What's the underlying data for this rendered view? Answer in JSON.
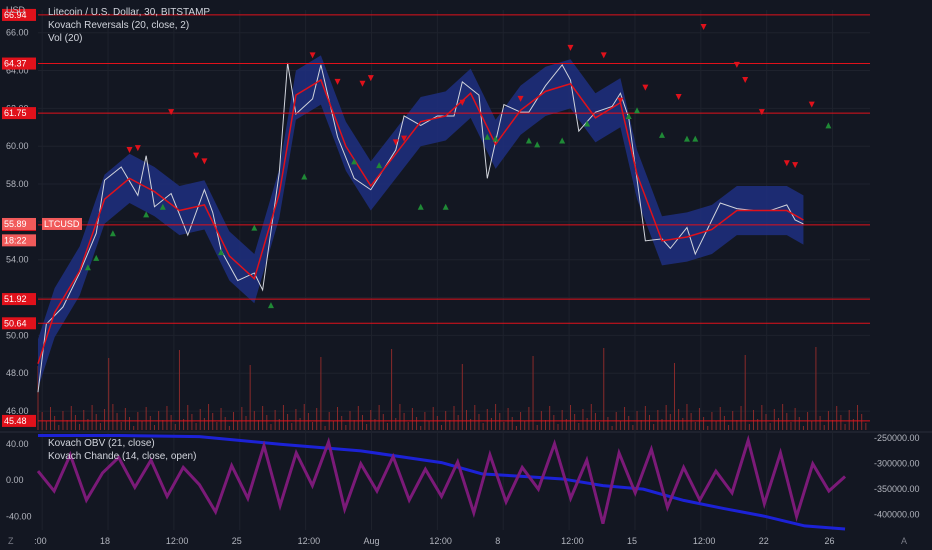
{
  "header": {
    "currency": "USD",
    "legend": [
      "Litecoin / U.S. Dollar, 30, BITSTAMP",
      "Kovach Reversals (20, close, 2)",
      "Vol (20)"
    ],
    "lower_legend": [
      "Kovach OBV (21, close)",
      "Kovach Chande (14, close, open)"
    ]
  },
  "footer": {
    "left_button": "Z",
    "right_button": "A"
  },
  "colors": {
    "background": "#131722",
    "level_line": "#e0111b",
    "price": "#d1d4dc",
    "band": "#1e2f80",
    "ma": "#e0111b",
    "signal_up": "#26a69a",
    "signal_down": "#e0111b",
    "obv": "#1c22d6",
    "chande": "#7b1a78",
    "volume": "#8a2a2a"
  },
  "chart_data": [
    {
      "type": "line",
      "title": "Litecoin / U.S. Dollar, 30, BITSTAMP",
      "symbol": "LTCUSD",
      "ylabel": "USD",
      "ylim": [
        45.0,
        67.2
      ],
      "y_ticks": [
        "46.00",
        "48.00",
        "50.00",
        "52.00",
        "54.00",
        "56.00",
        "58.00",
        "60.00",
        "62.00",
        "64.00",
        "66.00"
      ],
      "x_ticks": [
        ":00",
        "18",
        "12:00",
        "25",
        "12:00",
        "Aug",
        "12:00",
        "8",
        "12:00",
        "15",
        "12:00",
        "22",
        "26"
      ],
      "price_labels": [
        {
          "text": "55.89",
          "value": 55.89,
          "kind": "last"
        },
        {
          "text": "18:22",
          "value": 55.5,
          "kind": "countdown"
        },
        {
          "text": "LTCUSD",
          "value": 55.89,
          "kind": "symbol"
        }
      ],
      "levels": [
        {
          "text": "66.94",
          "value": 66.94
        },
        {
          "text": "64.37",
          "value": 64.37
        },
        {
          "text": "61.75",
          "value": 61.75
        },
        {
          "text": "55.84",
          "value": 55.84
        },
        {
          "text": "51.92",
          "value": 51.92
        },
        {
          "text": "50.64",
          "value": 50.64
        },
        {
          "text": "45.48",
          "value": 45.48
        }
      ],
      "series": [
        {
          "kind": "close",
          "points": [
            [
              0,
              47.0
            ],
            [
              0.01,
              50.6
            ],
            [
              0.03,
              51.5
            ],
            [
              0.05,
              53.3
            ],
            [
              0.07,
              55.4
            ],
            [
              0.08,
              58.2
            ],
            [
              0.1,
              58.9
            ],
            [
              0.12,
              57.4
            ],
            [
              0.13,
              59.5
            ],
            [
              0.14,
              56.8
            ],
            [
              0.16,
              57.5
            ],
            [
              0.18,
              55.3
            ],
            [
              0.2,
              57.7
            ],
            [
              0.21,
              56.5
            ],
            [
              0.22,
              54.5
            ],
            [
              0.24,
              52.9
            ],
            [
              0.26,
              53.3
            ],
            [
              0.27,
              52.4
            ],
            [
              0.29,
              58.6
            ],
            [
              0.3,
              64.4
            ],
            [
              0.31,
              61.7
            ],
            [
              0.33,
              62.5
            ],
            [
              0.34,
              64.3
            ],
            [
              0.36,
              60.5
            ],
            [
              0.38,
              58.3
            ],
            [
              0.4,
              57.7
            ],
            [
              0.41,
              58.4
            ],
            [
              0.43,
              59.8
            ],
            [
              0.44,
              61.6
            ],
            [
              0.46,
              61.1
            ],
            [
              0.48,
              61.6
            ],
            [
              0.5,
              61.6
            ],
            [
              0.51,
              63.4
            ],
            [
              0.53,
              62.7
            ],
            [
              0.54,
              58.3
            ],
            [
              0.56,
              62.2
            ],
            [
              0.58,
              61.8
            ],
            [
              0.59,
              61.8
            ],
            [
              0.61,
              63.2
            ],
            [
              0.63,
              64.3
            ],
            [
              0.64,
              63.5
            ],
            [
              0.65,
              60.8
            ],
            [
              0.67,
              61.8
            ],
            [
              0.69,
              62.1
            ],
            [
              0.7,
              62.8
            ],
            [
              0.71,
              61.5
            ],
            [
              0.73,
              55.0
            ],
            [
              0.75,
              55.1
            ],
            [
              0.76,
              54.6
            ],
            [
              0.78,
              55.7
            ],
            [
              0.79,
              54.3
            ],
            [
              0.81,
              56.1
            ],
            [
              0.82,
              57.0
            ],
            [
              0.84,
              56.7
            ],
            [
              0.86,
              56.6
            ],
            [
              0.88,
              56.6
            ],
            [
              0.9,
              56.9
            ],
            [
              0.91,
              56.1
            ],
            [
              0.92,
              55.89
            ]
          ]
        },
        {
          "kind": "reversals_ma",
          "points": [
            [
              0,
              48.5
            ],
            [
              0.02,
              51.2
            ],
            [
              0.05,
              53.4
            ],
            [
              0.08,
              57.2
            ],
            [
              0.11,
              58.3
            ],
            [
              0.14,
              57.6
            ],
            [
              0.17,
              56.6
            ],
            [
              0.2,
              56.9
            ],
            [
              0.23,
              54.2
            ],
            [
              0.26,
              53.0
            ],
            [
              0.29,
              57.5
            ],
            [
              0.31,
              62.7
            ],
            [
              0.34,
              63.5
            ],
            [
              0.37,
              60.0
            ],
            [
              0.4,
              57.9
            ],
            [
              0.43,
              59.6
            ],
            [
              0.46,
              61.3
            ],
            [
              0.49,
              61.6
            ],
            [
              0.52,
              62.8
            ],
            [
              0.55,
              60.1
            ],
            [
              0.58,
              61.9
            ],
            [
              0.61,
              62.9
            ],
            [
              0.64,
              63.3
            ],
            [
              0.67,
              61.5
            ],
            [
              0.7,
              62.3
            ],
            [
              0.72,
              58.5
            ],
            [
              0.75,
              55.0
            ],
            [
              0.78,
              55.2
            ],
            [
              0.81,
              55.6
            ],
            [
              0.84,
              56.6
            ],
            [
              0.87,
              56.6
            ],
            [
              0.9,
              56.6
            ],
            [
              0.92,
              56.1
            ]
          ]
        }
      ],
      "signals": [
        {
          "x": 0.06,
          "y": 53.6,
          "dir": "up"
        },
        {
          "x": 0.07,
          "y": 54.1,
          "dir": "up"
        },
        {
          "x": 0.09,
          "y": 55.4,
          "dir": "up"
        },
        {
          "x": 0.11,
          "y": 59.8,
          "dir": "down"
        },
        {
          "x": 0.12,
          "y": 59.9,
          "dir": "down"
        },
        {
          "x": 0.13,
          "y": 56.4,
          "dir": "up"
        },
        {
          "x": 0.15,
          "y": 56.8,
          "dir": "up"
        },
        {
          "x": 0.16,
          "y": 61.8,
          "dir": "down"
        },
        {
          "x": 0.19,
          "y": 59.5,
          "dir": "down"
        },
        {
          "x": 0.2,
          "y": 59.2,
          "dir": "down"
        },
        {
          "x": 0.22,
          "y": 54.4,
          "dir": "up"
        },
        {
          "x": 0.26,
          "y": 55.7,
          "dir": "up"
        },
        {
          "x": 0.28,
          "y": 51.6,
          "dir": "up"
        },
        {
          "x": 0.32,
          "y": 58.4,
          "dir": "up"
        },
        {
          "x": 0.33,
          "y": 64.8,
          "dir": "down"
        },
        {
          "x": 0.36,
          "y": 63.4,
          "dir": "down"
        },
        {
          "x": 0.38,
          "y": 59.2,
          "dir": "up"
        },
        {
          "x": 0.39,
          "y": 63.3,
          "dir": "down"
        },
        {
          "x": 0.4,
          "y": 63.6,
          "dir": "down"
        },
        {
          "x": 0.41,
          "y": 59.0,
          "dir": "up"
        },
        {
          "x": 0.43,
          "y": 60.2,
          "dir": "down"
        },
        {
          "x": 0.44,
          "y": 60.4,
          "dir": "down"
        },
        {
          "x": 0.46,
          "y": 56.8,
          "dir": "up"
        },
        {
          "x": 0.49,
          "y": 56.8,
          "dir": "up"
        },
        {
          "x": 0.51,
          "y": 62.3,
          "dir": "down"
        },
        {
          "x": 0.54,
          "y": 60.5,
          "dir": "up"
        },
        {
          "x": 0.55,
          "y": 60.4,
          "dir": "up"
        },
        {
          "x": 0.58,
          "y": 62.5,
          "dir": "down"
        },
        {
          "x": 0.59,
          "y": 60.3,
          "dir": "up"
        },
        {
          "x": 0.6,
          "y": 60.1,
          "dir": "up"
        },
        {
          "x": 0.63,
          "y": 60.3,
          "dir": "up"
        },
        {
          "x": 0.64,
          "y": 65.2,
          "dir": "down"
        },
        {
          "x": 0.66,
          "y": 61.2,
          "dir": "up"
        },
        {
          "x": 0.68,
          "y": 64.8,
          "dir": "down"
        },
        {
          "x": 0.7,
          "y": 62.4,
          "dir": "down"
        },
        {
          "x": 0.71,
          "y": 61.6,
          "dir": "up"
        },
        {
          "x": 0.72,
          "y": 61.9,
          "dir": "up"
        },
        {
          "x": 0.73,
          "y": 63.1,
          "dir": "down"
        },
        {
          "x": 0.75,
          "y": 60.6,
          "dir": "up"
        },
        {
          "x": 0.77,
          "y": 62.6,
          "dir": "down"
        },
        {
          "x": 0.78,
          "y": 60.4,
          "dir": "up"
        },
        {
          "x": 0.79,
          "y": 60.4,
          "dir": "up"
        },
        {
          "x": 0.8,
          "y": 66.3,
          "dir": "down"
        },
        {
          "x": 0.84,
          "y": 64.3,
          "dir": "down"
        },
        {
          "x": 0.85,
          "y": 63.5,
          "dir": "down"
        },
        {
          "x": 0.87,
          "y": 61.8,
          "dir": "down"
        },
        {
          "x": 0.9,
          "y": 59.1,
          "dir": "down"
        },
        {
          "x": 0.91,
          "y": 59.0,
          "dir": "down"
        },
        {
          "x": 0.93,
          "y": 62.2,
          "dir": "down"
        },
        {
          "x": 0.95,
          "y": 61.1,
          "dir": "up"
        }
      ]
    },
    {
      "type": "line",
      "title": "",
      "ylim": [
        -55,
        52
      ],
      "y_ticks": [
        "40.00",
        "0.00",
        "-40.00"
      ],
      "right_ticks": [
        "-250000.00",
        "-300000.00",
        "-350000.00",
        "-400000.00"
      ],
      "right_ylim": [
        -430000,
        -240000
      ],
      "series": [
        {
          "name": "Kovach OBV (21, close)",
          "axis": "right",
          "points": [
            [
              0,
              -245000
            ],
            [
              0.1,
              -245000
            ],
            [
              0.2,
              -247000
            ],
            [
              0.3,
              -262000
            ],
            [
              0.4,
              -275000
            ],
            [
              0.5,
              -298000
            ],
            [
              0.55,
              -320000
            ],
            [
              0.6,
              -325000
            ],
            [
              0.65,
              -330000
            ],
            [
              0.7,
              -343000
            ],
            [
              0.75,
              -350000
            ],
            [
              0.8,
              -372000
            ],
            [
              0.85,
              -388000
            ],
            [
              0.9,
              -403000
            ],
            [
              0.95,
              -422000
            ],
            [
              1,
              -428000
            ]
          ]
        },
        {
          "name": "Kovach Chande (14, close, open)",
          "axis": "left",
          "points": [
            [
              0,
              10
            ],
            [
              0.02,
              -12
            ],
            [
              0.04,
              28
            ],
            [
              0.06,
              -22
            ],
            [
              0.08,
              8
            ],
            [
              0.1,
              25
            ],
            [
              0.12,
              -8
            ],
            [
              0.14,
              22
            ],
            [
              0.16,
              -18
            ],
            [
              0.18,
              14
            ],
            [
              0.2,
              -5
            ],
            [
              0.22,
              -35
            ],
            [
              0.24,
              16
            ],
            [
              0.26,
              -20
            ],
            [
              0.28,
              38
            ],
            [
              0.3,
              -28
            ],
            [
              0.32,
              30
            ],
            [
              0.34,
              -6
            ],
            [
              0.36,
              42
            ],
            [
              0.38,
              -32
            ],
            [
              0.4,
              18
            ],
            [
              0.42,
              -12
            ],
            [
              0.44,
              26
            ],
            [
              0.46,
              -22
            ],
            [
              0.48,
              12
            ],
            [
              0.5,
              -18
            ],
            [
              0.52,
              20
            ],
            [
              0.54,
              -36
            ],
            [
              0.56,
              28
            ],
            [
              0.58,
              -24
            ],
            [
              0.6,
              14
            ],
            [
              0.62,
              -10
            ],
            [
              0.64,
              40
            ],
            [
              0.66,
              -20
            ],
            [
              0.68,
              22
            ],
            [
              0.7,
              -48
            ],
            [
              0.72,
              30
            ],
            [
              0.74,
              -14
            ],
            [
              0.76,
              34
            ],
            [
              0.78,
              -30
            ],
            [
              0.8,
              14
            ],
            [
              0.82,
              -22
            ],
            [
              0.84,
              10
            ],
            [
              0.86,
              -14
            ],
            [
              0.88,
              44
            ],
            [
              0.9,
              -26
            ],
            [
              0.92,
              30
            ],
            [
              0.94,
              -40
            ],
            [
              0.96,
              18
            ],
            [
              0.98,
              -12
            ],
            [
              1,
              4
            ]
          ]
        }
      ]
    }
  ]
}
